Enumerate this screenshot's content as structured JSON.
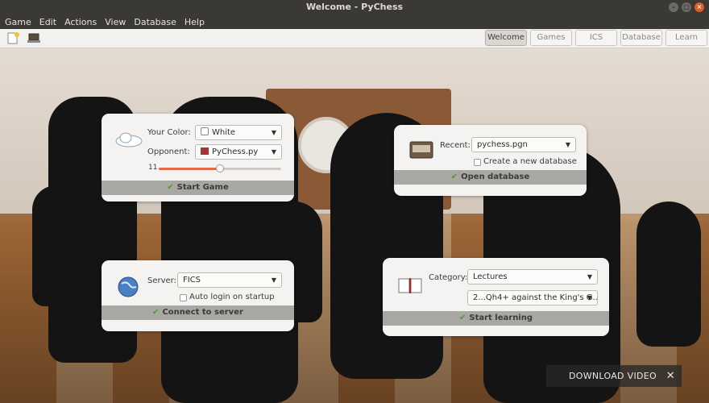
{
  "window": {
    "title": "Welcome - PyChess"
  },
  "menu": [
    "Game",
    "Edit",
    "Actions",
    "View",
    "Database",
    "Help"
  ],
  "tabs": [
    {
      "label": "Welcome",
      "active": true
    },
    {
      "label": "Games",
      "active": false
    },
    {
      "label": "ICS",
      "active": false
    },
    {
      "label": "Database",
      "active": false
    },
    {
      "label": "Learn",
      "active": false
    }
  ],
  "new_game": {
    "color_label": "Your Color:",
    "color_value": "White",
    "opponent_label": "Opponent:",
    "opponent_value": "PyChess.py",
    "level": "11",
    "level_fraction": 0.5,
    "button": "Start Game"
  },
  "database": {
    "recent_label": "Recent:",
    "recent_value": "pychess.pgn",
    "create_label": "Create a new database",
    "button": "Open database"
  },
  "server": {
    "server_label": "Server:",
    "server_value": "FICS",
    "autologin_label": "Auto login on startup",
    "button": "Connect to server"
  },
  "learn": {
    "category_label": "Category:",
    "category_value": "Lectures",
    "lesson_value": "2...Qh4+ against the King's G...",
    "button": "Start learning"
  },
  "overlay": {
    "download_label": "DOWNLOAD VIDEO",
    "close_glyph": "✕"
  },
  "colors": {
    "accent_check": "#4f9a1e",
    "slider_fill": "#e2694a",
    "titlebar": "#3a3936"
  }
}
